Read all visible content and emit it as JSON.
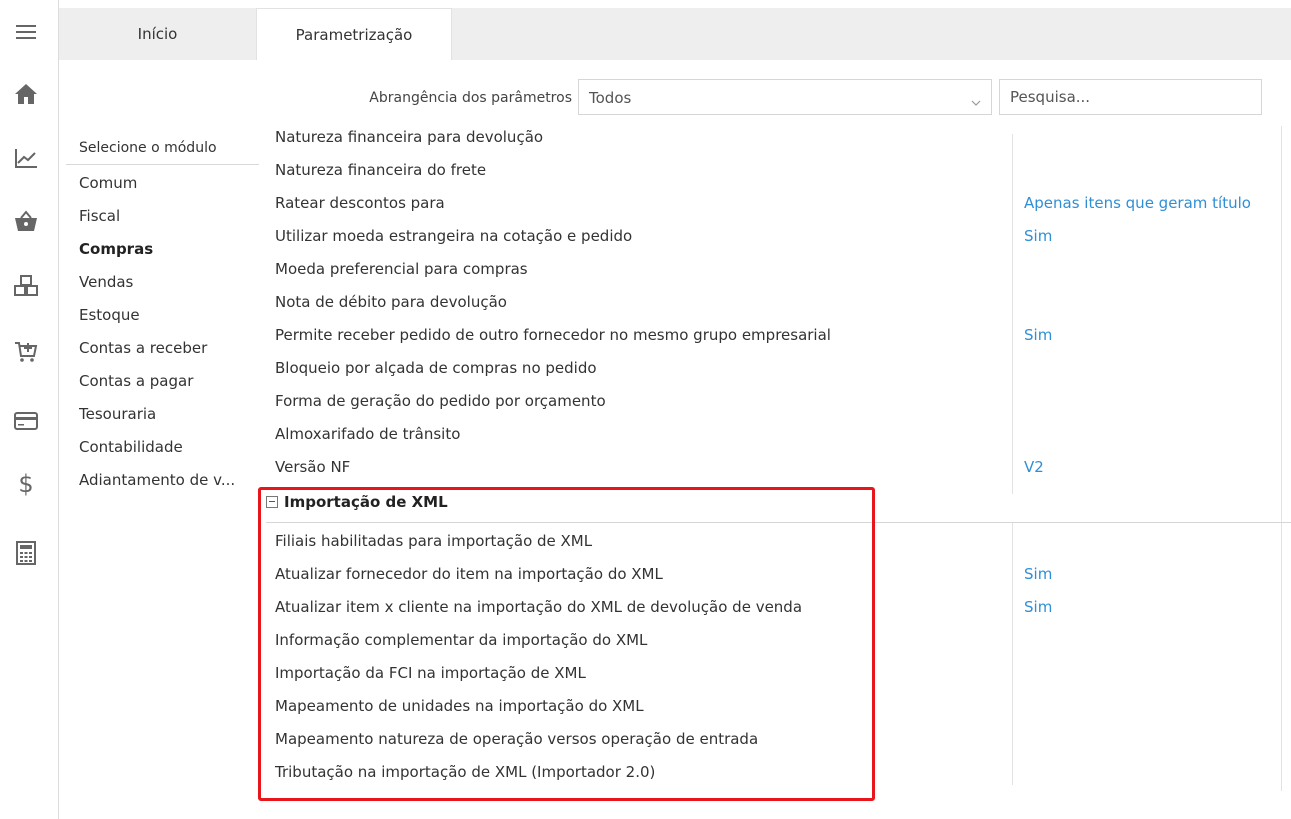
{
  "sidebar": {
    "icons": [
      "menu-icon",
      "home-icon",
      "chart-icon",
      "basket-icon",
      "boxes-icon",
      "cart-add-icon",
      "credit-card-icon",
      "dollar-icon",
      "calculator-icon"
    ]
  },
  "tabs": [
    {
      "label": "Início"
    },
    {
      "label": "Parametrização"
    }
  ],
  "filters": {
    "scope_label": "Abrangência dos parâmetros",
    "scope_value": "Todos",
    "search_placeholder": "Pesquisa..."
  },
  "modules": {
    "header": "Selecione o módulo",
    "items": [
      "Comum",
      "Fiscal",
      "Compras",
      "Vendas",
      "Estoque",
      "Contas a receber",
      "Contas a pagar",
      "Tesouraria",
      "Contabilidade",
      "Adiantamento de v..."
    ],
    "selected": "Compras"
  },
  "params": [
    {
      "label": "Natureza financeira para devolução",
      "value": ""
    },
    {
      "label": "Natureza financeira do frete",
      "value": ""
    },
    {
      "label": "Ratear descontos para",
      "value": "Apenas itens que geram título"
    },
    {
      "label": "Utilizar moeda estrangeira na cotação e pedido",
      "value": "Sim"
    },
    {
      "label": "Moeda preferencial para compras",
      "value": ""
    },
    {
      "label": "Nota de débito para devolução",
      "value": ""
    },
    {
      "label": "Permite receber pedido de outro fornecedor no mesmo grupo empresarial",
      "value": "Sim"
    },
    {
      "label": "Bloqueio por alçada de compras no pedido",
      "value": ""
    },
    {
      "label": "Forma de geração do pedido por orçamento",
      "value": ""
    },
    {
      "label": "Almoxarifado de trânsito",
      "value": ""
    },
    {
      "label": "Versão NF",
      "value": "V2"
    }
  ],
  "xml_group": {
    "title": "Importação de XML",
    "params": [
      {
        "label": "Filiais habilitadas para importação de XML",
        "value": ""
      },
      {
        "label": "Atualizar fornecedor do item na importação do XML",
        "value": "Sim"
      },
      {
        "label": "Atualizar item x cliente na importação do XML de devolução de venda",
        "value": "Sim"
      },
      {
        "label": "Informação complementar da importação do XML",
        "value": ""
      },
      {
        "label": "Importação da FCI na importação de XML",
        "value": ""
      },
      {
        "label": "Mapeamento de unidades na importação do XML",
        "value": ""
      },
      {
        "label": "Mapeamento natureza de operação versos operação de entrada",
        "value": ""
      },
      {
        "label": "Tributação na importação de XML (Importador 2.0)",
        "value": ""
      }
    ]
  },
  "colors": {
    "value_blue": "#2f8fd6",
    "highlight_red": "#e8151b",
    "icon_gray": "#666666"
  }
}
